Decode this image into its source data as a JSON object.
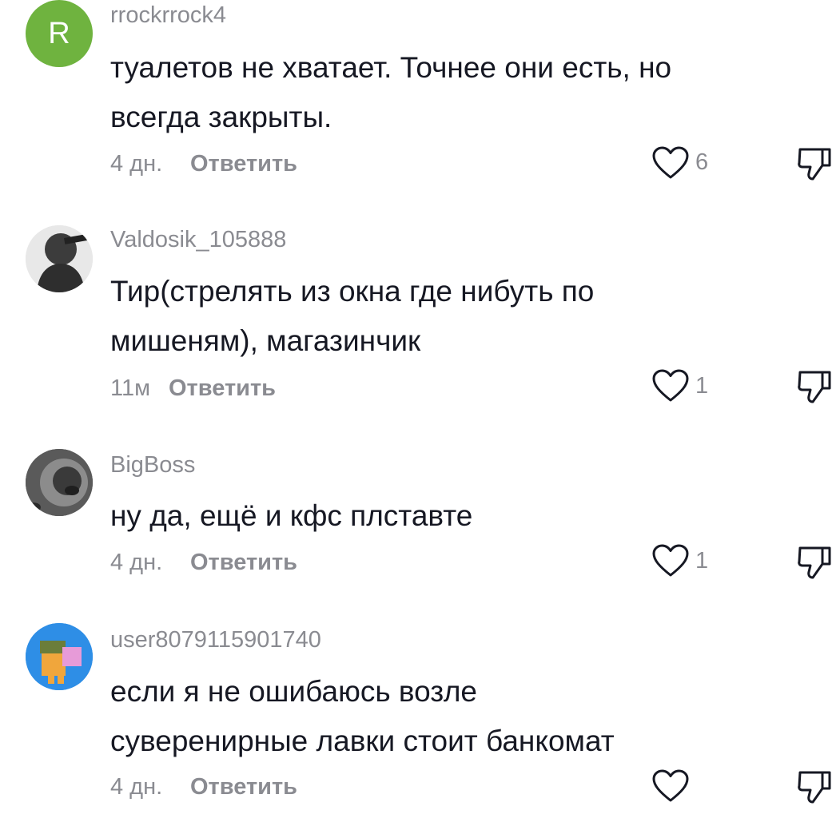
{
  "comments": [
    {
      "username": "rrockrrock4",
      "avatar_letter": "R",
      "avatar_color": "#6fb33f",
      "text_lines": [
        "туалетов не хватает. Точнее они есть, но",
        "всегда закрыты."
      ],
      "time": "4 дн.",
      "reply_label": "Ответить",
      "likes": "6",
      "like_icon": "heart-outline-icon",
      "dislike_icon": "thumbs-down-icon"
    },
    {
      "username": "Valdosik_105888",
      "avatar_color": "#bfbfbf",
      "text_lines": [
        "Тир(стрелять из окна где нибуть по",
        "мишеням), магазинчик"
      ],
      "time": "11м",
      "reply_label": "Ответить",
      "likes": "1",
      "like_icon": "heart-outline-icon",
      "dislike_icon": "thumbs-down-icon"
    },
    {
      "username": "BigBoss",
      "avatar_color": "#4a4a4a",
      "text_lines": [
        "ну да, ещё и кфс плставте"
      ],
      "time": "4 дн.",
      "reply_label": "Ответить",
      "likes": "1",
      "like_icon": "heart-outline-icon",
      "dislike_icon": "thumbs-down-icon"
    },
    {
      "username": "user8079115901740",
      "avatar_color": "#2e8ee6",
      "text_lines": [
        "если я не ошибаюсь возле",
        "суверенирные лавки стоит банкомат"
      ],
      "time": "4 дн.",
      "reply_label": "Ответить",
      "likes": "",
      "like_icon": "heart-outline-icon",
      "dislike_icon": "thumbs-down-icon"
    }
  ],
  "colors": {
    "text": "#161823",
    "secondary": "#8a8b91",
    "background": "#ffffff"
  }
}
